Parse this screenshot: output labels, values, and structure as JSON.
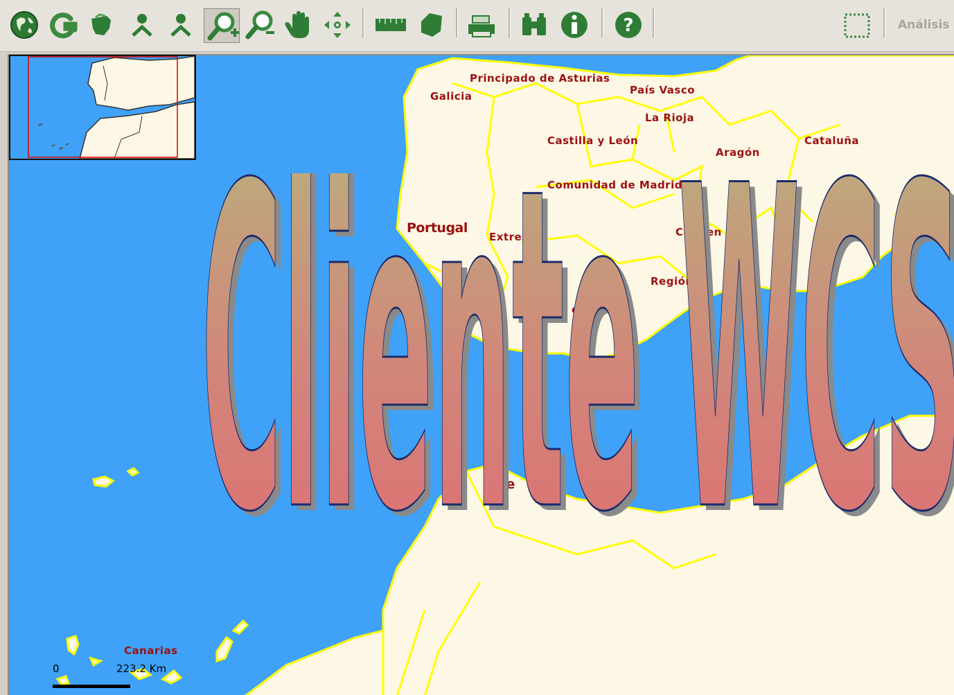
{
  "toolbar": {
    "buttons": [
      {
        "name": "globe-icon",
        "group": 1
      },
      {
        "name": "refresh-icon",
        "group": 1
      },
      {
        "name": "layers-icon",
        "group": 1
      },
      {
        "name": "user-icon",
        "group": 1
      },
      {
        "name": "user-check-icon",
        "group": 1
      },
      {
        "name": "zoom-in-icon",
        "group": 1,
        "pressed": true
      },
      {
        "name": "zoom-out-icon",
        "group": 1
      },
      {
        "name": "pan-hand-icon",
        "group": 1
      },
      {
        "name": "move-arrows-icon",
        "group": 1
      },
      {
        "name": "measure-line-icon",
        "group": 2
      },
      {
        "name": "measure-area-icon",
        "group": 2
      },
      {
        "name": "print-icon",
        "group": 3
      },
      {
        "name": "binoculars-icon",
        "group": 4
      },
      {
        "name": "info-icon",
        "group": 4
      },
      {
        "name": "help-icon",
        "group": 5
      },
      {
        "name": "select-area-icon",
        "group": 6
      }
    ],
    "analysis_label": "Análisis"
  },
  "map": {
    "regions": [
      {
        "key": "asturias",
        "label": "Principado de Asturias"
      },
      {
        "key": "galicia",
        "label": "Galicia"
      },
      {
        "key": "pais_vasco",
        "label": "País Vasco"
      },
      {
        "key": "la_rioja",
        "label": "La Rioja"
      },
      {
        "key": "castilla_leon",
        "label": "Castilla y León"
      },
      {
        "key": "cataluna",
        "label": "Cataluña"
      },
      {
        "key": "aragon",
        "label": "Aragón"
      },
      {
        "key": "madrid",
        "label": "Comunidad de Madrid"
      },
      {
        "key": "portugal",
        "label": "Portugal"
      },
      {
        "key": "extremadura",
        "label": "Extrema"
      },
      {
        "key": "valencia",
        "label": "Co        d        en"
      },
      {
        "key": "murcia",
        "label": "Región"
      },
      {
        "key": "andalucia",
        "label": "da"
      },
      {
        "key": "marruecos",
        "label": "M    e"
      },
      {
        "key": "canarias",
        "label": "Canarias"
      }
    ],
    "scale": {
      "zero_label": "0",
      "distance_label": "223.2 Km"
    },
    "watermark": "Cliente WCS",
    "colors": {
      "sea": "#3fa2f8",
      "land": "#fdf7e6",
      "border": "#ffff00",
      "label": "#9c1010"
    }
  }
}
